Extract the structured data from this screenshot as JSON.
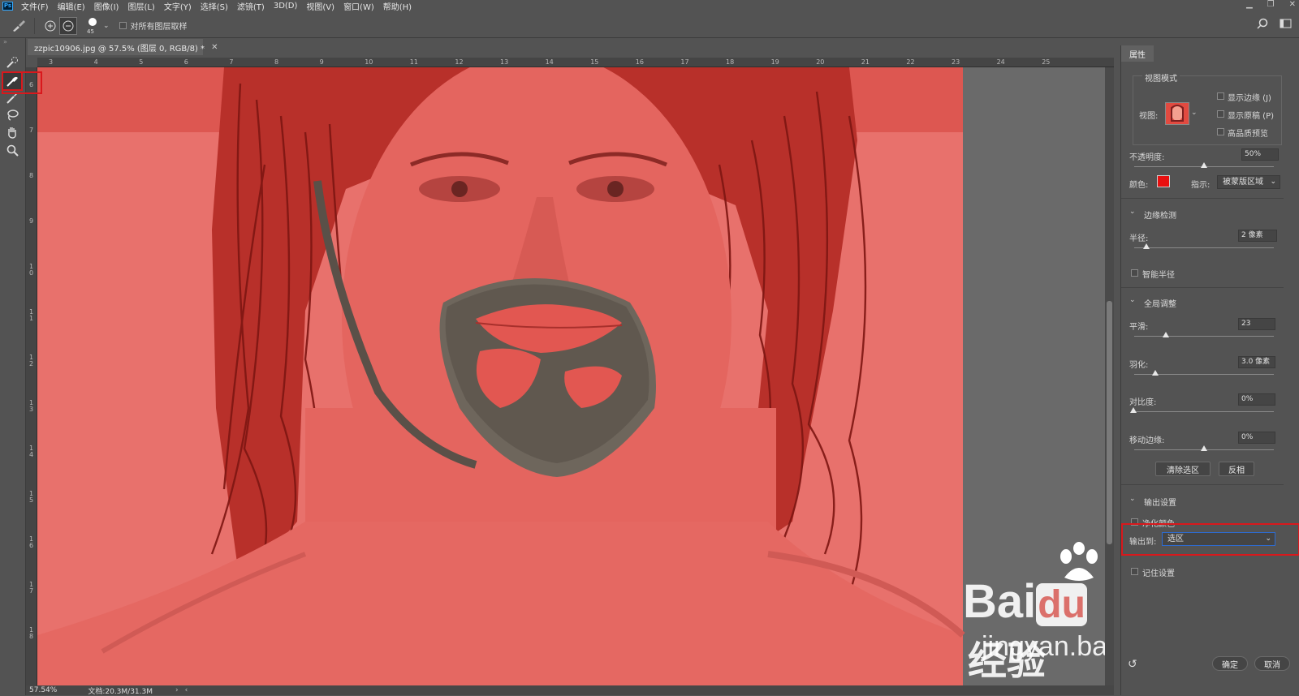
{
  "menubar": {
    "items": [
      "文件(F)",
      "编辑(E)",
      "图像(I)",
      "图层(L)",
      "文字(Y)",
      "选择(S)",
      "滤镜(T)",
      "3D(D)",
      "视图(V)",
      "窗口(W)",
      "帮助(H)"
    ]
  },
  "options": {
    "brush_size": "45",
    "sample_all_layers": "对所有图层取样"
  },
  "document": {
    "tab_title": "zzpic10906.jpg @ 57.5% (图层 0, RGB/8) *",
    "hruler": [
      "3",
      "4",
      "5",
      "6",
      "7",
      "8",
      "9",
      "10",
      "11",
      "12",
      "13",
      "14",
      "15",
      "16",
      "17",
      "18",
      "19",
      "20",
      "21",
      "22",
      "23",
      "24",
      "25"
    ],
    "vruler": [
      "6",
      "7",
      "8",
      "9",
      "10",
      "11",
      "12",
      "13",
      "14",
      "15",
      "16",
      "17",
      "18"
    ],
    "zoom": "57.54%",
    "doc_info": "文档:20.3M/31.3M"
  },
  "panel": {
    "title": "属性",
    "view_mode": {
      "title": "视图模式",
      "view_label": "视图:",
      "show_edge": "显示边缘 (J)",
      "show_original": "显示原稿 (P)",
      "hq_preview": "高品质预览",
      "opacity_label": "不透明度:",
      "opacity_value": "50%",
      "opacity_level": 0.5,
      "color_label": "颜色:",
      "color_value": "#e81010",
      "indicate_label": "指示:",
      "indicate_value": "被蒙版区域"
    },
    "edge_detection": {
      "title": "边缘检测",
      "radius_label": "半径:",
      "radius_value": "2 像素",
      "smart_radius": "智能半径"
    },
    "global_refine": {
      "title": "全局调整",
      "smooth_label": "平滑:",
      "smooth_value": "23",
      "feather_label": "羽化:",
      "feather_value": "3.0 像素",
      "contrast_label": "对比度:",
      "contrast_value": "0%",
      "shift_edge_label": "移动边缘:",
      "shift_edge_value": "0%",
      "clear_selection": "清除选区",
      "invert": "反相"
    },
    "output": {
      "title": "输出设置",
      "decontaminate": "净化颜色",
      "output_to_label": "输出到:",
      "output_to_value": "选区",
      "remember": "记住设置"
    },
    "ok": "确定",
    "cancel": "取消"
  },
  "watermark": {
    "brand": "Bai",
    "brand2": "du",
    "cn": "经验",
    "url": "jingyan.baidu.com"
  }
}
